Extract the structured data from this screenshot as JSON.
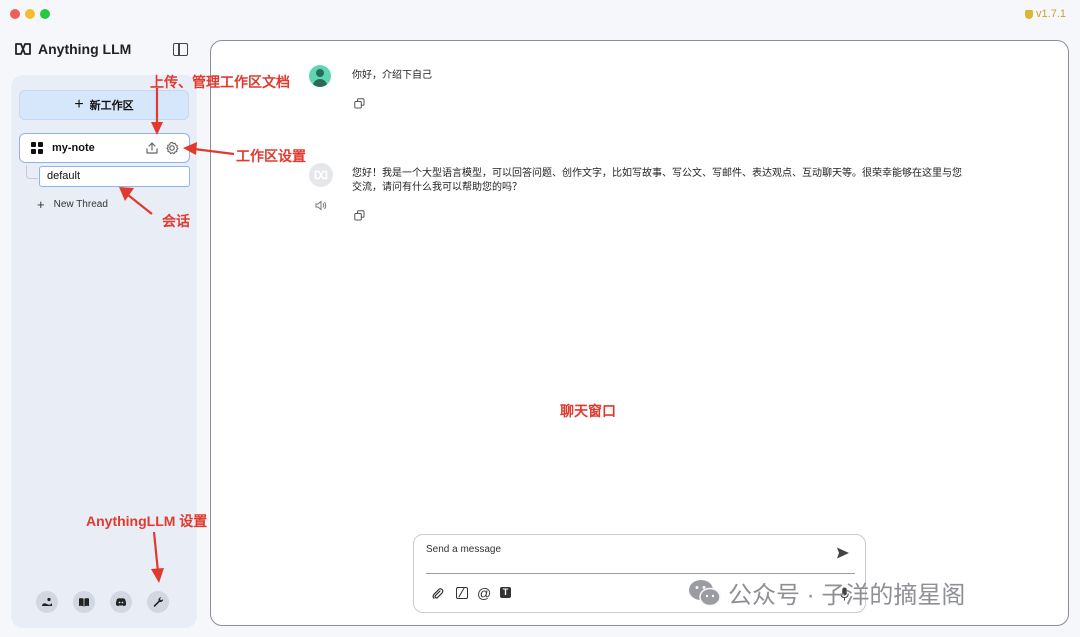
{
  "app": {
    "version": "v1.7.1",
    "brand": "Anything LLM"
  },
  "sidebar": {
    "new_workspace_label": "新工作区",
    "workspace": {
      "name": "my-note"
    },
    "thread": {
      "name": "default"
    },
    "new_thread_label": "New Thread",
    "footer_icons": [
      "community-icon",
      "docs-book-icon",
      "discord-icon",
      "settings-wrench-icon"
    ]
  },
  "chat": {
    "messages": [
      {
        "role": "user",
        "text": "你好，介绍下自己"
      },
      {
        "role": "assistant",
        "text_line1": "您好！我是一个大型语言模型，可以回答问题、创作文字，比如写故事、写公文、写邮件、表达观点、互动聊天等。很荣幸能够在这里与您",
        "text_line2": "交流，请问有什么我可以帮助您的吗？"
      }
    ],
    "composer": {
      "placeholder": "Send a message",
      "at_symbol": "@",
      "text_tool_letter": "T"
    }
  },
  "annotations": {
    "upload": "上传、管理工作区文档",
    "workspace_settings": "工作区设置",
    "session": "会话",
    "chat_window": "聊天窗口",
    "app_settings": "AnythingLLM 设置"
  },
  "watermark": "公众号 · 子洋的摘星阁",
  "colors": {
    "annotation": "#e03a2f",
    "accent_blue": "#8fb4ec",
    "new_workspace_bg": "#d7e7fb"
  }
}
